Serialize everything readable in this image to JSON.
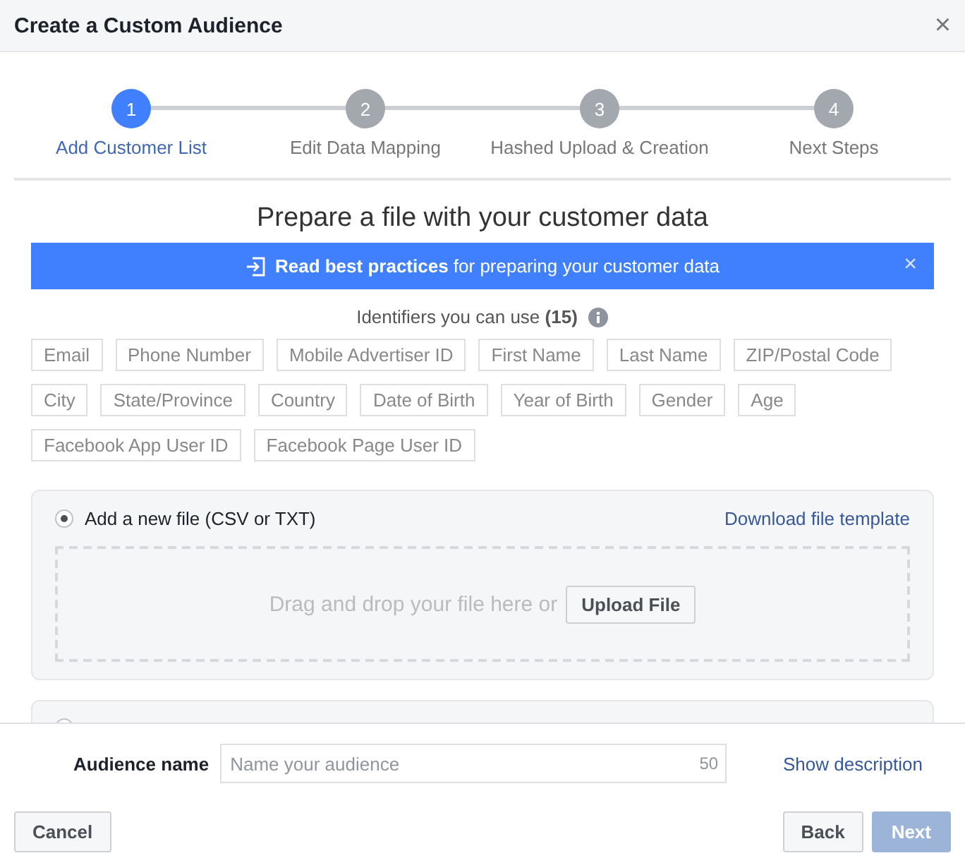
{
  "window": {
    "title": "Create a Custom Audience",
    "close": "×"
  },
  "steps": [
    {
      "number": "1",
      "label": "Add Customer List",
      "selected": true
    },
    {
      "number": "2",
      "label": "Edit Data Mapping",
      "selected": false
    },
    {
      "number": "3",
      "label": "Hashed Upload & Creation",
      "selected": false
    },
    {
      "number": "4",
      "label": "Next Steps",
      "selected": false
    }
  ],
  "heading": "Prepare a file with your customer data",
  "banner": {
    "text": "**Read best practices** for preparing your customer data",
    "close": "×"
  },
  "identifiers": {
    "label": "Identifiers you can use **(15)**",
    "items": [
      "Email",
      "Phone Number",
      "Mobile Advertiser ID",
      "First Name",
      "Last Name",
      "ZIP/Postal Code",
      "City",
      "State/Province",
      "Country",
      "Date of Birth",
      "Year of Birth",
      "Gender",
      "Age",
      "Facebook App User ID",
      "Facebook Page User ID"
    ]
  },
  "options": [
    {
      "label": "Add a new file (CSV or TXT)",
      "selected": true,
      "link": "Download file template",
      "drop_text": "Drag and drop your file here or",
      "upload_button": "Upload File"
    },
    {
      "selected": false
    }
  ],
  "audience_name": {
    "label": "Audience name",
    "placeholder": "Name your audience",
    "counter": "50",
    "link": "Show description"
  },
  "buttons": {
    "cancel": "Cancel",
    "back": "Back",
    "next": {
      "label": "Next",
      "disabled": true
    }
  }
}
